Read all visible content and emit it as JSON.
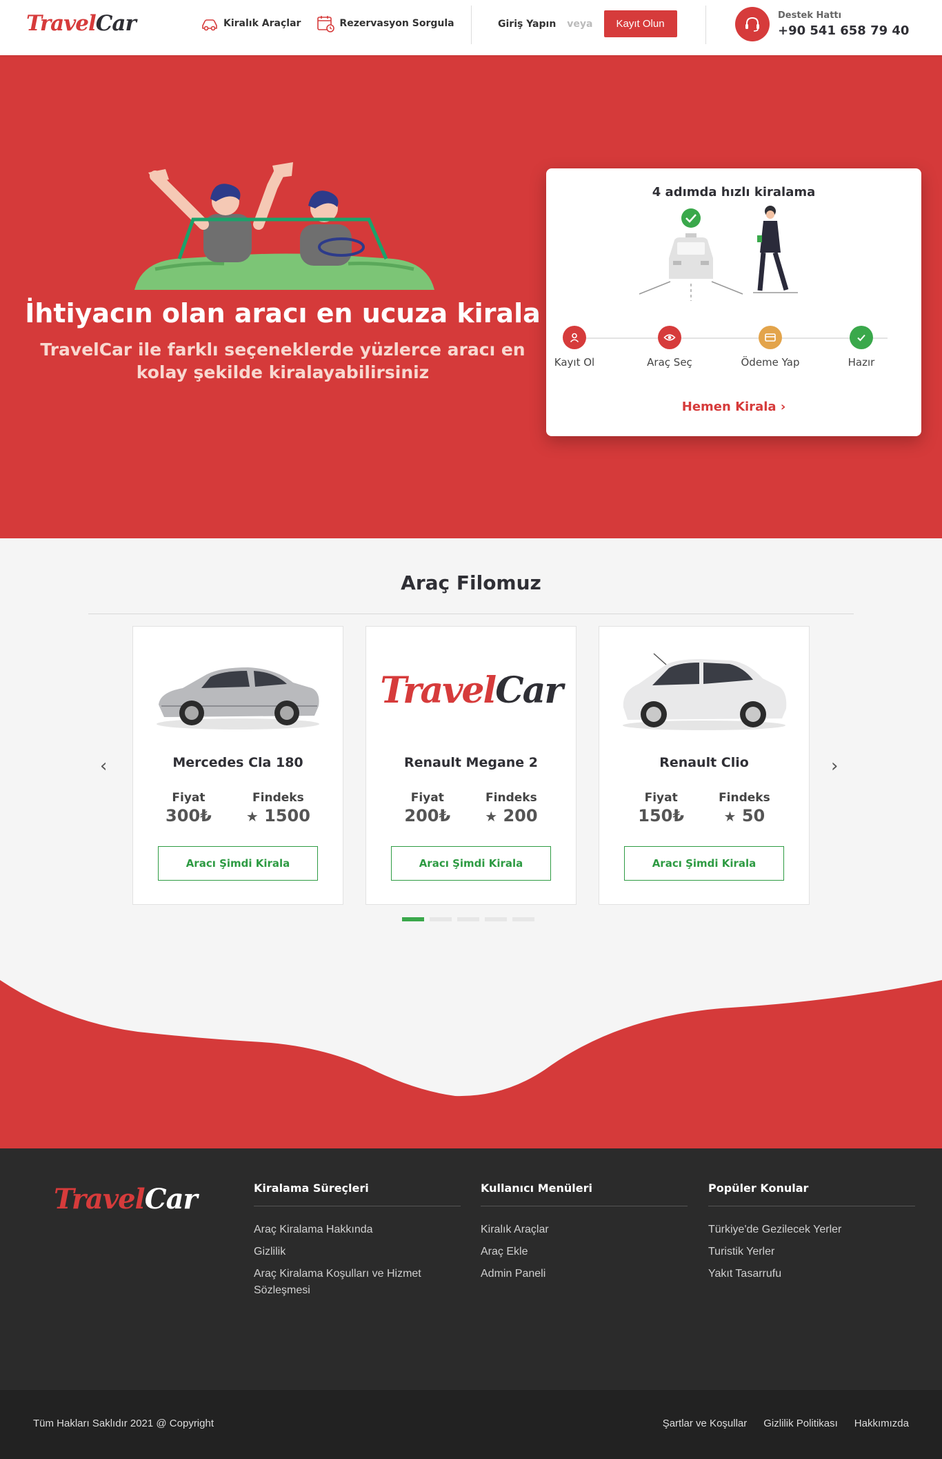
{
  "brand": {
    "logo_part1": "Travel",
    "logo_part2": "Car"
  },
  "nav": {
    "items": [
      {
        "label": "Kiralık Araçlar",
        "icon": "car-icon"
      },
      {
        "label": "Rezervasyon Sorgula",
        "icon": "calendar-icon"
      }
    ],
    "login_label": "Giriş Yapın",
    "or_label": "veya",
    "register_label": "Kayıt Olun"
  },
  "support": {
    "label": "Destek Hattı",
    "phone": "+90 541 658 79 40",
    "icon": "headset-icon"
  },
  "hero": {
    "title": "İhtiyacın olan aracı en ucuza kirala",
    "subtitle": "TravelCar ile farklı seçeneklerde yüzlerce aracı en kolay şekilde kiralayabilirsiniz"
  },
  "steps_card": {
    "title": "4 adımda hızlı kiralama",
    "steps": [
      {
        "label": "Kayıt Ol",
        "icon": "user-icon",
        "color": "#d63b3b"
      },
      {
        "label": "Araç Seç",
        "icon": "eye-icon",
        "color": "#d63b3b"
      },
      {
        "label": "Ödeme Yap",
        "icon": "credit-card-icon",
        "color": "#e3a44b"
      },
      {
        "label": "Hazır",
        "icon": "check-icon",
        "color": "#3aa84b"
      }
    ],
    "cta_label": "Hemen Kirala"
  },
  "fleet": {
    "title": "Araç Filomuz",
    "price_label": "Fiyat",
    "findeks_label": "Findeks",
    "button_label": "Aracı Şimdi Kirala",
    "cars": [
      {
        "name": "Mercedes Cla 180",
        "price": "300₺",
        "findeks": "1500"
      },
      {
        "name": "Renault Megane 2",
        "price": "200₺",
        "findeks": "200"
      },
      {
        "name": "Renault Clio",
        "price": "150₺",
        "findeks": "50"
      }
    ],
    "active_page": 1,
    "total_pages": 5
  },
  "footer": {
    "columns": [
      {
        "title": "Kiralama Süreçleri",
        "links": [
          "Araç Kiralama Hakkında",
          "Gizlilik",
          "Araç Kiralama Koşulları ve Hizmet Sözleşmesi"
        ]
      },
      {
        "title": "Kullanıcı Menüleri",
        "links": [
          "Kiralık Araçlar",
          "Araç Ekle",
          "Admin Paneli"
        ]
      },
      {
        "title": "Popüler Konular",
        "links": [
          "Türkiye'de Gezilecek Yerler",
          "Turistik Yerler",
          "Yakıt Tasarrufu"
        ]
      }
    ],
    "copyright": "Tüm Hakları Saklıdır 2021 @ Copyright",
    "bottom_links": [
      "Şartlar ve Koşullar",
      "Gizlilik Politikası",
      "Hakkımızda"
    ]
  },
  "colors": {
    "brand_red": "#d53a3a",
    "green": "#3aa84b",
    "footer_dark": "#2b2b2b"
  }
}
